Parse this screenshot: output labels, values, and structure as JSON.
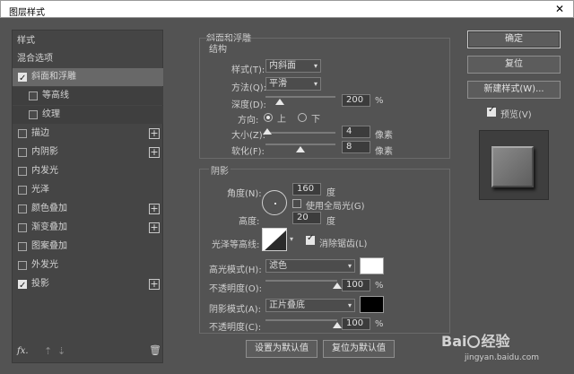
{
  "window": {
    "title": "图层样式",
    "close_glyph": "✕"
  },
  "left": {
    "header": "样式",
    "blend_options": "混合选项",
    "items": [
      {
        "label": "斜面和浮雕",
        "checked": true,
        "plus": false,
        "selected": true
      },
      {
        "label": "等高线",
        "checked": false,
        "plus": false,
        "sub": true
      },
      {
        "label": "纹理",
        "checked": false,
        "plus": false,
        "sub": true
      },
      {
        "label": "描边",
        "checked": false,
        "plus": true
      },
      {
        "label": "内阴影",
        "checked": false,
        "plus": true
      },
      {
        "label": "内发光",
        "checked": false,
        "plus": false
      },
      {
        "label": "光泽",
        "checked": false,
        "plus": false
      },
      {
        "label": "颜色叠加",
        "checked": false,
        "plus": true
      },
      {
        "label": "渐变叠加",
        "checked": false,
        "plus": true
      },
      {
        "label": "图案叠加",
        "checked": false,
        "plus": false
      },
      {
        "label": "外发光",
        "checked": false,
        "plus": false
      },
      {
        "label": "投影",
        "checked": true,
        "plus": true
      }
    ],
    "fx_label": "fx",
    "fx_dot": ".",
    "up_glyph": "⇡",
    "down_glyph": "⇣",
    "trash_glyph": "🗑"
  },
  "bevel": {
    "section_title": "斜面和浮雕",
    "structure_title": "结构",
    "style_label": "样式(T):",
    "style_value": "内斜面",
    "technique_label": "方法(Q):",
    "technique_value": "平滑",
    "depth_label": "深度(D):",
    "depth_value": "200",
    "depth_unit": "%",
    "depth_level": 0.2,
    "direction_label": "方向:",
    "dir_up": "上",
    "dir_down": "下",
    "dir_selected": "up",
    "size_label": "大小(Z):",
    "size_value": "4",
    "size_unit": "像素",
    "size_level": 0.02,
    "soften_label": "软化(F):",
    "soften_value": "8",
    "soften_unit": "像素",
    "soften_level": 0.5
  },
  "shading": {
    "title": "阴影",
    "angle_label": "角度(N):",
    "angle_value": "160",
    "angle_unit": "度",
    "global_light_label": "使用全局光(G)",
    "global_light": false,
    "altitude_label": "高度:",
    "altitude_value": "20",
    "altitude_unit": "度",
    "gloss_label": "光泽等高线:",
    "antialias_label": "消除锯齿(L)",
    "antialias": true,
    "highlight_mode_label": "高光模式(H):",
    "highlight_mode_value": "滤色",
    "highlight_color": "#ffffff",
    "highlight_opacity_label": "不透明度(O):",
    "highlight_opacity_value": "100",
    "highlight_opacity_unit": "%",
    "highlight_opacity_level": 1.0,
    "shadow_mode_label": "阴影模式(A):",
    "shadow_mode_value": "正片叠底",
    "shadow_color": "#000000",
    "shadow_opacity_label": "不透明度(C):",
    "shadow_opacity_value": "100",
    "shadow_opacity_unit": "%",
    "shadow_opacity_level": 1.0
  },
  "footer": {
    "set_default": "设置为默认值",
    "reset_default": "复位为默认值"
  },
  "right": {
    "ok": "确定",
    "reset": "复位",
    "new_style": "新建样式(W)...",
    "preview_label": "预览(V)",
    "preview": true
  },
  "watermark": {
    "brand": "Bai",
    "brand2": "经验",
    "url": "jingyan.baidu.com"
  }
}
